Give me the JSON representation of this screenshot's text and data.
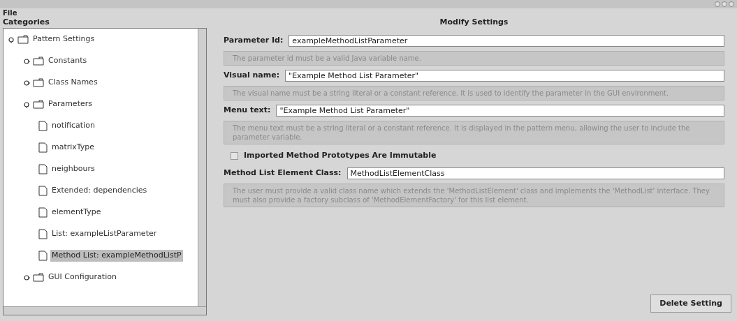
{
  "menu": [
    "File"
  ],
  "categories": {
    "title": "Categories",
    "tree": [
      {
        "label": "Pattern Settings",
        "kind": "folder",
        "expanded": true,
        "selected": false,
        "children": [
          {
            "label": "Constants",
            "kind": "folder",
            "expanded": false,
            "selected": false
          },
          {
            "label": "Class Names",
            "kind": "folder",
            "expanded": false,
            "selected": false
          },
          {
            "label": "Parameters",
            "kind": "folder",
            "expanded": true,
            "selected": false,
            "children": [
              {
                "label": "notification",
                "kind": "file",
                "selected": false
              },
              {
                "label": "matrixType",
                "kind": "file",
                "selected": false
              },
              {
                "label": "neighbours",
                "kind": "file",
                "selected": false
              },
              {
                "label": "Extended: dependencies",
                "kind": "file",
                "selected": false
              },
              {
                "label": "elementType",
                "kind": "file",
                "selected": false
              },
              {
                "label": "List: exampleListParameter",
                "kind": "file",
                "selected": false
              },
              {
                "label": "Method List: exampleMethodListP",
                "kind": "file",
                "selected": true
              }
            ]
          },
          {
            "label": "GUI Configuration",
            "kind": "folder",
            "expanded": false,
            "selected": false
          }
        ]
      }
    ]
  },
  "settings": {
    "title": "Modify Settings",
    "rows": [
      {
        "kind": "field",
        "label": "Parameter Id:",
        "value": "exampleMethodListParameter"
      },
      {
        "kind": "help",
        "text": "The parameter id must be a valid Java variable name."
      },
      {
        "kind": "field",
        "label": "Visual name:",
        "value": "\"Example Method List Parameter\""
      },
      {
        "kind": "help",
        "text": "The visual name must be a string literal or a constant reference. It is used to identify the parameter in the GUI environment."
      },
      {
        "kind": "field",
        "label": "Menu text:",
        "value": "\"Example Method List Parameter\""
      },
      {
        "kind": "help",
        "text": "The menu text must be a string literal or a constant reference. It is displayed in the pattern menu, allowing the user to include the parameter variable."
      },
      {
        "kind": "checkbox",
        "label": "Imported Method Prototypes Are Immutable",
        "checked": false
      },
      {
        "kind": "field",
        "label": "Method List Element Class:",
        "value": "MethodListElementClass"
      },
      {
        "kind": "help",
        "text": "The user must provide a valid class name which extends the 'MethodListElement' class and implements the 'MethodList' interface. They must also provide a factory subclass of 'MethodElementFactory' for this list element."
      }
    ],
    "delete_button": "Delete Setting"
  }
}
